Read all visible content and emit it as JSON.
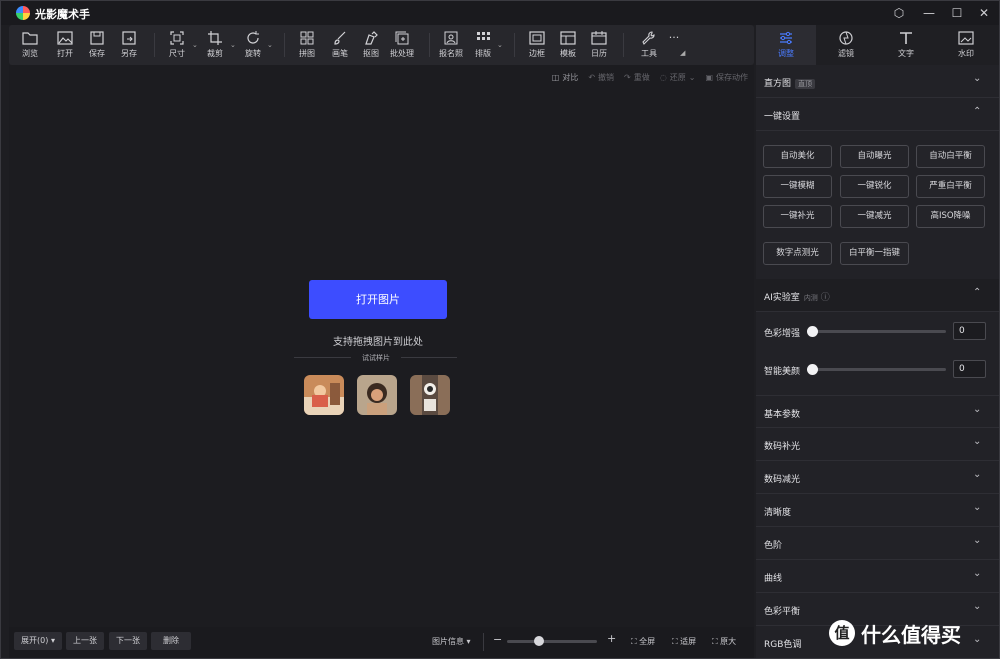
{
  "app": {
    "title": "光影魔术手"
  },
  "toolbar": {
    "items": [
      {
        "label": "浏览",
        "icon": "folder-icon"
      },
      {
        "label": "打开",
        "icon": "image-open-icon"
      },
      {
        "label": "保存",
        "icon": "save-icon"
      },
      {
        "label": "另存",
        "icon": "save-as-icon"
      },
      {
        "label": "尺寸",
        "icon": "resize-icon"
      },
      {
        "label": "裁剪",
        "icon": "crop-icon"
      },
      {
        "label": "旋转",
        "icon": "rotate-icon"
      },
      {
        "label": "拼图",
        "icon": "collage-icon"
      },
      {
        "label": "画笔",
        "icon": "brush-icon"
      },
      {
        "label": "抠图",
        "icon": "cutout-icon"
      },
      {
        "label": "批处理",
        "icon": "batch-icon"
      },
      {
        "label": "报名照",
        "icon": "id-photo-icon"
      },
      {
        "label": "排版",
        "icon": "layout-icon"
      },
      {
        "label": "边框",
        "icon": "frame-icon"
      },
      {
        "label": "模板",
        "icon": "template-icon"
      },
      {
        "label": "日历",
        "icon": "calendar-icon"
      },
      {
        "label": "工具",
        "icon": "wrench-icon"
      }
    ],
    "more": "···"
  },
  "right_tabs": [
    {
      "label": "调整",
      "icon": "sliders-icon",
      "active": true
    },
    {
      "label": "滤镜",
      "icon": "filter-icon",
      "active": false
    },
    {
      "label": "文字",
      "icon": "text-icon",
      "active": false
    },
    {
      "label": "水印",
      "icon": "watermark-icon",
      "active": false
    }
  ],
  "subbar": {
    "compare": "对比",
    "undo": "撤销",
    "redo": "重做",
    "restore": "还原",
    "save_action": "保存动作"
  },
  "canvas": {
    "open_button": "打开图片",
    "drag_hint": "支持拖拽图片到此处",
    "sample_label": "试试样片"
  },
  "bottombar": {
    "expand": "展开(0)",
    "prev": "上一张",
    "next": "下一张",
    "delete": "删除",
    "image_info": "图片信息",
    "zoom_minus": "−",
    "zoom_plus": "+",
    "zoom_level": 0.35,
    "fullscreen": "全屏",
    "fit": "适屏",
    "original": "原大"
  },
  "panel": {
    "histogram": {
      "title": "直方图",
      "tag": "直顶"
    },
    "quick": {
      "title": "一键设置",
      "buttons": [
        "自动美化",
        "自动曝光",
        "自动白平衡",
        "一键模糊",
        "一键锐化",
        "严重白平衡",
        "一键补光",
        "一键减光",
        "高ISO降噪",
        "数字点测光",
        "白平衡一指键"
      ]
    },
    "ai_lab": {
      "title": "AI实验室",
      "hint": "内测",
      "params": [
        {
          "label": "色彩增强",
          "value": "0"
        },
        {
          "label": "智能美颜",
          "value": "0"
        }
      ]
    },
    "sections": [
      "基本参数",
      "数码补光",
      "数码减光",
      "清晰度",
      "色阶",
      "曲线",
      "色彩平衡",
      "RGB色调"
    ]
  },
  "watermark": {
    "glyph": "值",
    "text": "什么值得买"
  }
}
